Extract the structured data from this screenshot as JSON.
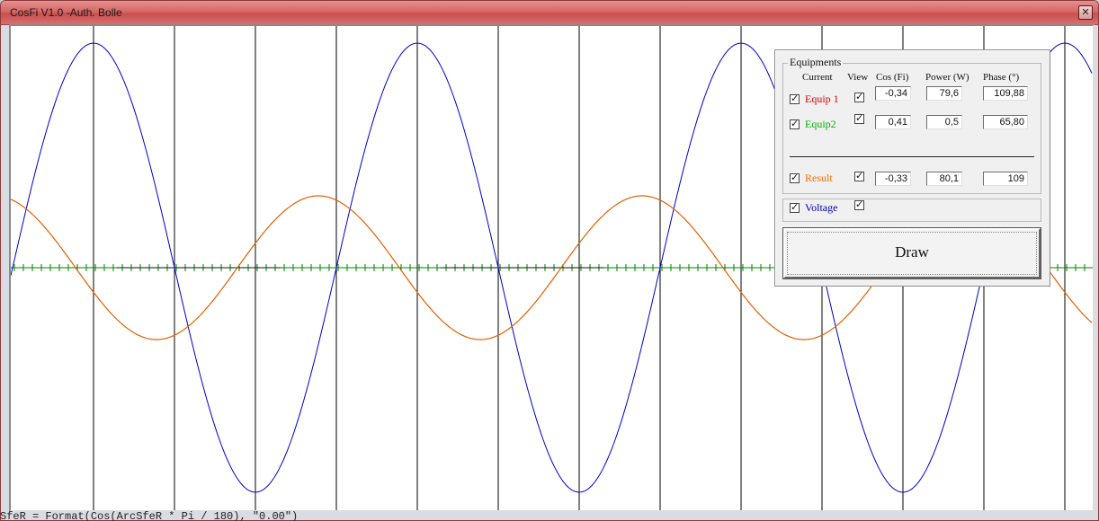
{
  "window": {
    "title": "CosFi V1.0 -Auth. Bolle",
    "close_glyph": "✕"
  },
  "status_line": "SfeR = Format(Cos(ArcSfeR * Pi / 180), \"0.00\")",
  "panel": {
    "group_title": "Equipments",
    "headers": {
      "current": "Current",
      "view": "View",
      "cos": "Cos (Fi)",
      "power": "Power (W)",
      "phase": "Phase (°)"
    },
    "equip1": {
      "name": "Equip 1",
      "cos": "-0,34",
      "power": "79,6",
      "phase": "109,88",
      "color": "#e00000"
    },
    "equip2": {
      "name": "Equip2",
      "cos": "0,41",
      "power": "0,5",
      "phase": "65,80",
      "color": "#00b000"
    },
    "result": {
      "name": "Result",
      "cos": "-0,33",
      "power": "80,1",
      "phase": "109",
      "color": "#f07000"
    },
    "voltage": {
      "name": "Voltage",
      "color": "#0000b0"
    },
    "draw_label": "Draw"
  },
  "colors": {
    "voltage_wave": "#0000cc",
    "result_wave": "#e06000",
    "axis": "#008000",
    "titlebar": "#d66767"
  }
}
